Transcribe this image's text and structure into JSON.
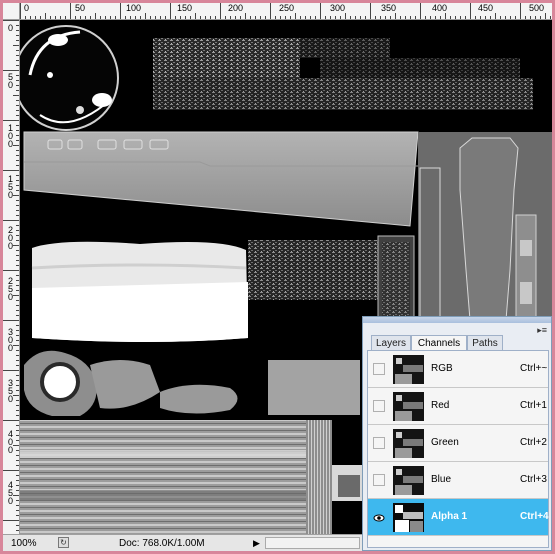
{
  "ruler_top_labels": [
    "0",
    "50",
    "100",
    "150",
    "200",
    "250",
    "300",
    "350",
    "400",
    "450",
    "500"
  ],
  "ruler_left_labels": [
    "0",
    "5 0",
    "1 0 0",
    "1 5 0",
    "2 0 0",
    "2 5 0",
    "3 0 0",
    "3 5 0",
    "4 0 0",
    "4 5 0"
  ],
  "panel": {
    "tabs": [
      {
        "label": "Layers",
        "active": false
      },
      {
        "label": "Channels",
        "active": true
      },
      {
        "label": "Paths",
        "active": false
      }
    ],
    "channels": [
      {
        "name": "RGB",
        "shortcut": "Ctrl+~",
        "visible": false,
        "selected": false
      },
      {
        "name": "Red",
        "shortcut": "Ctrl+1",
        "visible": false,
        "selected": false
      },
      {
        "name": "Green",
        "shortcut": "Ctrl+2",
        "visible": false,
        "selected": false
      },
      {
        "name": "Blue",
        "shortcut": "Ctrl+3",
        "visible": false,
        "selected": false
      },
      {
        "name": "Alpha 1",
        "shortcut": "Ctrl+4",
        "visible": true,
        "selected": true
      }
    ],
    "eye_icon": "eye-icon"
  },
  "status": {
    "zoom": "100%",
    "doc_info": "Doc: 768.0K/1.00M",
    "arrow": "▶"
  },
  "colors": {
    "window_border": "#d8869a",
    "selection": "#3eb8ee",
    "canvas": "#000000"
  }
}
